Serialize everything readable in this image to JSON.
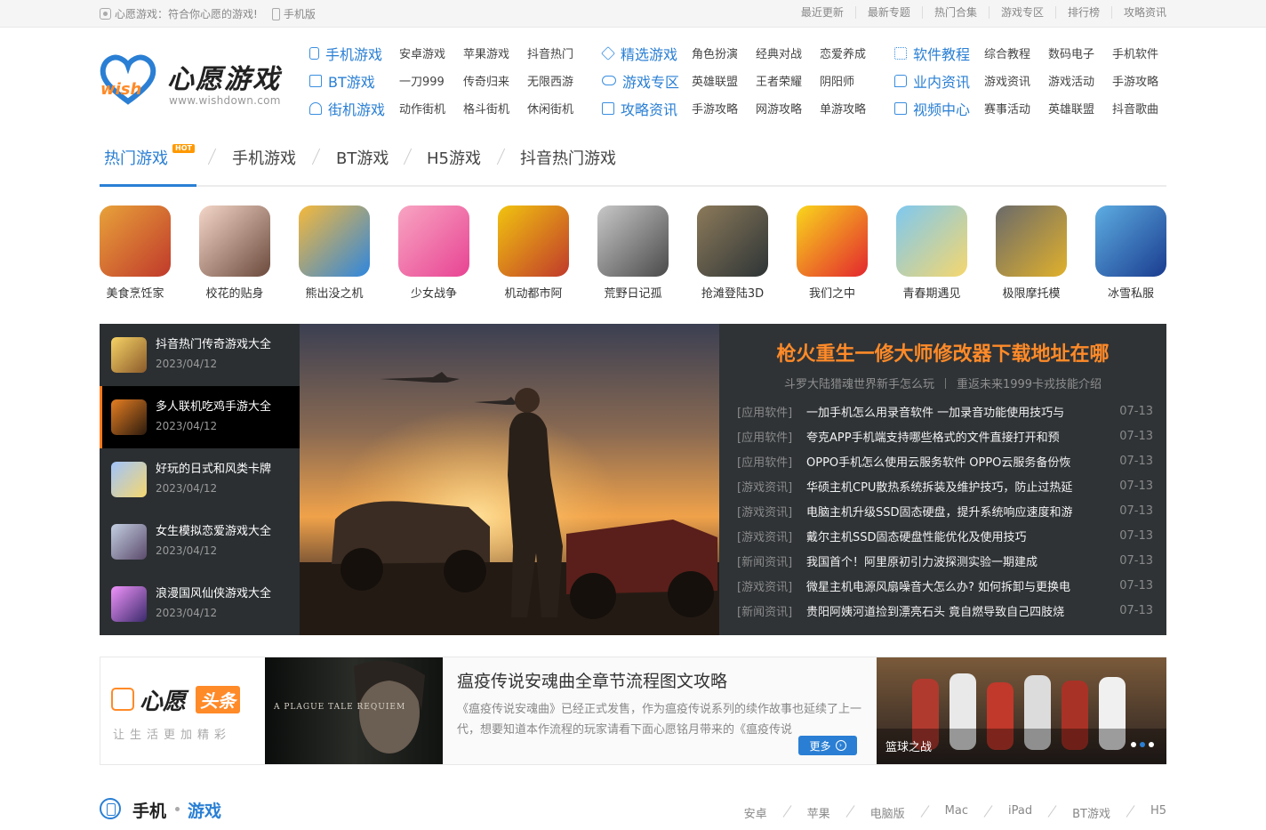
{
  "topbar": {
    "welcome": "心愿游戏：符合你心愿的游戏!",
    "mobile": "手机版",
    "links": [
      "最近更新",
      "最新专题",
      "热门合集",
      "游戏专区",
      "排行榜",
      "攻略资讯"
    ]
  },
  "logo": {
    "brand": "心愿游戏",
    "url": "www.wishdown.com",
    "mark": "wish"
  },
  "nav": [
    {
      "rows": [
        {
          "main": "手机游戏",
          "icon": "phone-icon",
          "subs": [
            "安卓游戏",
            "苹果游戏",
            "抖音热门"
          ]
        },
        {
          "main": "BT游戏",
          "icon": "bt-icon",
          "subs": [
            "一刀999",
            "传奇归来",
            "无限西游"
          ]
        },
        {
          "main": "街机游戏",
          "icon": "joystick-icon",
          "subs": [
            "动作街机",
            "格斗街机",
            "休闲街机"
          ]
        }
      ]
    },
    {
      "rows": [
        {
          "main": "精选游戏",
          "icon": "diamond-icon",
          "subs": [
            "角色扮演",
            "经典对战",
            "恋爱养成"
          ]
        },
        {
          "main": "游戏专区",
          "icon": "gamepad-icon",
          "subs": [
            "英雄联盟",
            "王者荣耀",
            "阴阳师"
          ]
        },
        {
          "main": "攻略资讯",
          "icon": "document-icon",
          "subs": [
            "手游攻略",
            "网游攻略",
            "单游攻略"
          ]
        }
      ]
    },
    {
      "rows": [
        {
          "main": "软件教程",
          "icon": "apps-icon",
          "subs": [
            "综合教程",
            "数码电子",
            "手机软件"
          ]
        },
        {
          "main": "业内资讯",
          "icon": "chat-icon",
          "subs": [
            "游戏资讯",
            "游戏活动",
            "手游攻略"
          ]
        },
        {
          "main": "视频中心",
          "icon": "video-icon",
          "subs": [
            "赛事活动",
            "英雄联盟",
            "抖音歌曲"
          ]
        }
      ]
    }
  ],
  "cattabs": {
    "items": [
      "热门游戏",
      "手机游戏",
      "BT游戏",
      "H5游戏",
      "抖音热门游戏"
    ],
    "hot": "HOT"
  },
  "games": [
    {
      "name": "美食烹饪家",
      "colors": [
        "#e8a23a",
        "#c0392b"
      ]
    },
    {
      "name": "校花的贴身",
      "colors": [
        "#f4d6c8",
        "#6b4a3c"
      ]
    },
    {
      "name": "熊出没之机",
      "colors": [
        "#f6b93b",
        "#2e86de"
      ]
    },
    {
      "name": "少女战争",
      "colors": [
        "#f8a5c2",
        "#e84393"
      ]
    },
    {
      "name": "机动都市阿",
      "colors": [
        "#f1c40f",
        "#c0392b"
      ]
    },
    {
      "name": "荒野日记孤",
      "colors": [
        "#c8c8c8",
        "#4a4a4a"
      ]
    },
    {
      "name": "抢滩登陆3D",
      "colors": [
        "#8c7a5a",
        "#2d3436"
      ]
    },
    {
      "name": "我们之中",
      "colors": [
        "#f9d71c",
        "#e3262e"
      ]
    },
    {
      "name": "青春期遇见",
      "colors": [
        "#7ec8f0",
        "#f5d76e"
      ]
    },
    {
      "name": "极限摩托模",
      "colors": [
        "#6a6a6a",
        "#e1b12c"
      ]
    },
    {
      "name": "冰雪私服",
      "colors": [
        "#5dade2",
        "#1a3c8f"
      ]
    }
  ],
  "feature": {
    "list": [
      {
        "title": "抖音热门传奇游戏大全",
        "date": "2023/04/12"
      },
      {
        "title": "多人联机吃鸡手游大全",
        "date": "2023/04/12"
      },
      {
        "title": "好玩的日式和风类卡牌",
        "date": "2023/04/12"
      },
      {
        "title": "女生模拟恋爱游戏大全",
        "date": "2023/04/12"
      },
      {
        "title": "浪漫国风仙侠游戏大全",
        "date": "2023/04/12"
      }
    ],
    "headline": "枪火重生一修大师修改器下载地址在哪",
    "sub_left": "斗罗大陆猎魂世界新手怎么玩",
    "sub_right": "重返未来1999卡戎技能介绍",
    "news": [
      {
        "cat": "[应用软件]",
        "title": "一加手机怎么用录音软件 一加录音功能使用技巧与",
        "date": "07-13"
      },
      {
        "cat": "[应用软件]",
        "title": "夸克APP手机端支持哪些格式的文件直接打开和预",
        "date": "07-13"
      },
      {
        "cat": "[应用软件]",
        "title": "OPPO手机怎么使用云服务软件 OPPO云服务备份恢",
        "date": "07-13"
      },
      {
        "cat": "[游戏资讯]",
        "title": "华硕主机CPU散热系统拆装及维护技巧，防止过热延",
        "date": "07-13"
      },
      {
        "cat": "[游戏资讯]",
        "title": "电脑主机升级SSD固态硬盘，提升系统响应速度和游",
        "date": "07-13"
      },
      {
        "cat": "[游戏资讯]",
        "title": "戴尔主机SSD固态硬盘性能优化及使用技巧",
        "date": "07-13"
      },
      {
        "cat": "[新闻资讯]",
        "title": "我国首个！阿里原初引力波探测实验一期建成",
        "date": "07-13"
      },
      {
        "cat": "[游戏资讯]",
        "title": "微星主机电源风扇噪音大怎么办? 如何拆卸与更换电",
        "date": "07-13"
      },
      {
        "cat": "[新闻资讯]",
        "title": "贵阳阿姨河道捡到漂亮石头 竟自燃导致自己四肢烧",
        "date": "07-13"
      }
    ]
  },
  "strip": {
    "logo_a": "心愿",
    "logo_b": "头条",
    "slogan": "让生活更加精彩",
    "poster_text": "A PLAGUE TALE REQUIEM",
    "title": "瘟疫传说安魂曲全章节流程图文攻略",
    "desc": "《瘟疫传说安魂曲》已经正式发售，作为瘟疫传说系列的续作故事也延续了上一代，想要知道本作流程的玩家请看下面心愿铭月带来的《瘟疫传说",
    "more": "更多",
    "side_caption": "篮球之战"
  },
  "section": {
    "title_a": "手机",
    "title_b": "游戏",
    "links": [
      "安卓",
      "苹果",
      "电脑版",
      "Mac",
      "iPad",
      "BT游戏",
      "H5"
    ]
  },
  "colors": {
    "accent": "#2a7fd4",
    "orange": "#ff8a28"
  }
}
